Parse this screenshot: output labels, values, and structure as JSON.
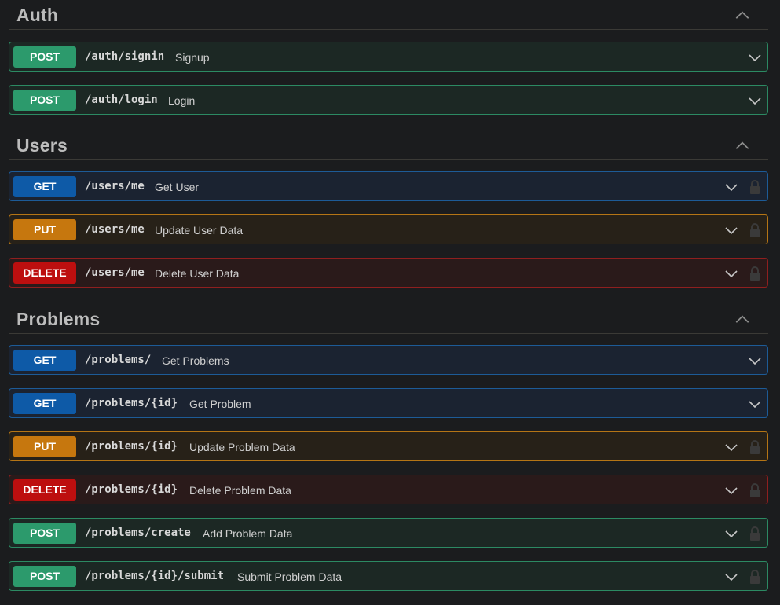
{
  "sections": [
    {
      "title": "Auth",
      "operations": [
        {
          "method": "POST",
          "path": "/auth/signin",
          "summary": "Signup"
        },
        {
          "method": "POST",
          "path": "/auth/login",
          "summary": "Login"
        }
      ]
    },
    {
      "title": "Users",
      "operations": [
        {
          "method": "GET",
          "path": "/users/me",
          "summary": "Get User"
        },
        {
          "method": "PUT",
          "path": "/users/me",
          "summary": "Update User Data"
        },
        {
          "method": "DELETE",
          "path": "/users/me",
          "summary": "Delete User Data"
        }
      ]
    },
    {
      "title": "Problems",
      "operations": [
        {
          "method": "GET",
          "path": "/problems/",
          "summary": "Get Problems"
        },
        {
          "method": "GET",
          "path": "/problems/{id}",
          "summary": "Get Problem"
        },
        {
          "method": "PUT",
          "path": "/problems/{id}",
          "summary": "Update Problem Data"
        },
        {
          "method": "DELETE",
          "path": "/problems/{id}",
          "summary": "Delete Problem Data"
        },
        {
          "method": "POST",
          "path": "/problems/create",
          "summary": "Add Problem Data"
        },
        {
          "method": "POST",
          "path": "/problems/{id}/submit",
          "summary": "Submit Problem Data"
        }
      ]
    }
  ],
  "colors": {
    "post": "#2c9a6c",
    "get": "#0e5aa7",
    "put": "#c6770e",
    "delete": "#bd0f0f"
  },
  "icons": {
    "collapse": "chevron-up-icon",
    "expand": "chevron-down-icon",
    "auth": "lock-icon"
  }
}
